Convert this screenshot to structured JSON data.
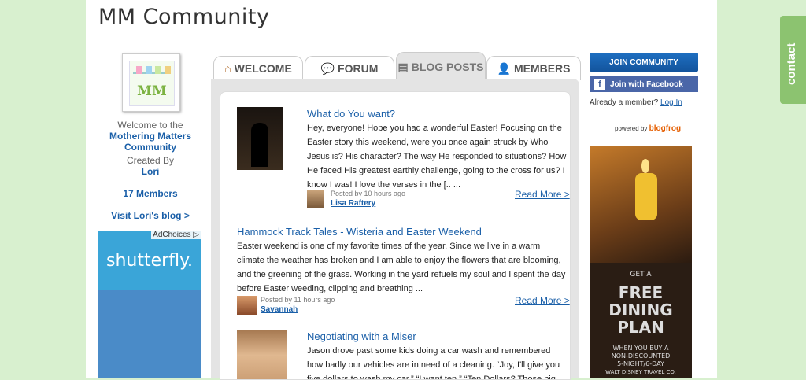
{
  "site": {
    "title": "MM Community"
  },
  "left": {
    "welcome_to": "Welcome to the",
    "community_name_line1": "Mothering Matters",
    "community_name_line2": "Community",
    "created_by": "Created By",
    "creator": "Lori",
    "members": "17 Members",
    "visit_blog": "Visit Lori's blog >",
    "adchoices": "AdChoices",
    "ad_brand": "shutterfly."
  },
  "tabs": [
    {
      "label": "WELCOME"
    },
    {
      "label": "FORUM"
    },
    {
      "label": "BLOG POSTS"
    },
    {
      "label": "MEMBERS"
    }
  ],
  "posts": [
    {
      "title": "What do You want?",
      "body": "Hey, everyone! Hope you had a wonderful Easter! Focusing on the Easter story this weekend, were you once again struck by Who Jesus is? His character? The way He responded to situations? How He faced His greatest earthly challenge, going to the cross for us? I know I was! I love the verses in the [.. ...",
      "posted": "Posted by 10 hours ago",
      "author": "Lisa Raftery",
      "read_more": "Read More >"
    },
    {
      "title": "Hammock Track Tales - Wisteria and Easter Weekend",
      "body": "Easter weekend is one of my favorite times of the year.  Since we live in a warm climate the weather has broken and I am able to enjoy the flowers that are blooming, and the greening of the grass.  Working in the yard refuels my soul and I spent the day before Easter weeding, clipping and breathing ...",
      "posted": "Posted by 11 hours ago",
      "author": "Savannah",
      "read_more": "Read More >"
    },
    {
      "title": "Negotiating with a Miser",
      "body": "Jason drove past some kids doing a car wash and remembered how badly our vehicles are in need of a cleaning.  “Joy, I'll give you five dollars to wash my car.” “I want ten.” “Ten Dollars?  Those big"
    }
  ],
  "right": {
    "join": "JOIN COMMUNITY",
    "facebook": "Join with Facebook",
    "already": "Already a member?",
    "login": "Log In",
    "powered_by": "powered by",
    "powered_brand": "blogfrog",
    "ad_get": "GET A",
    "ad_free": "FREE",
    "ad_dining": "DINING",
    "ad_plan": "PLAN",
    "ad_when": "WHEN YOU BUY A",
    "ad_non": "NON-DISCOUNTED",
    "ad_night": "5-NIGHT/6-DAY",
    "ad_wdw": "WALT DISNEY TRAVEL CO."
  },
  "contact": "contact",
  "colors": {
    "link": "#1a5fa8",
    "background": "#d8f0cf",
    "contact_tab": "#8cc370"
  }
}
